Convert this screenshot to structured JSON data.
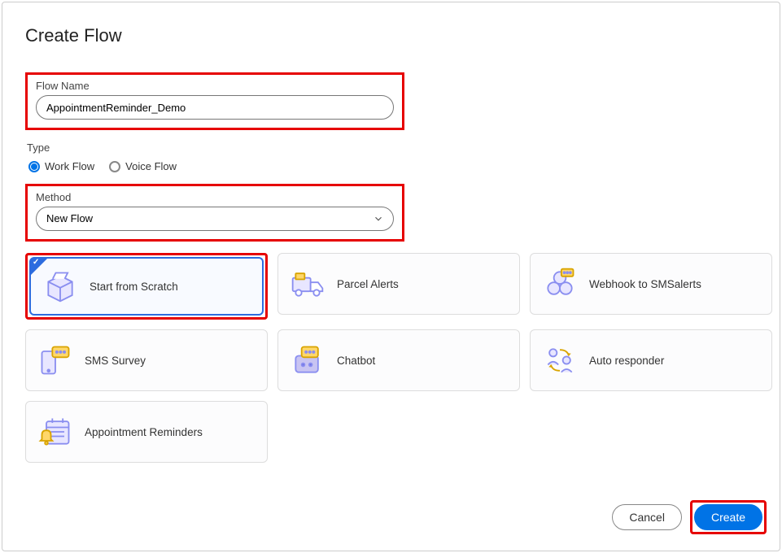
{
  "title": "Create Flow",
  "flowName": {
    "label": "Flow Name",
    "value": "AppointmentReminder_Demo"
  },
  "type": {
    "label": "Type",
    "options": [
      {
        "label": "Work Flow",
        "checked": true
      },
      {
        "label": "Voice Flow",
        "checked": false
      }
    ]
  },
  "method": {
    "label": "Method",
    "value": "New Flow"
  },
  "templates": [
    {
      "label": "Start from Scratch",
      "icon": "box",
      "selected": true
    },
    {
      "label": "Parcel Alerts",
      "icon": "truck",
      "selected": false
    },
    {
      "label": "Webhook to SMSalerts",
      "icon": "webhook",
      "selected": false
    },
    {
      "label": "SMS Survey",
      "icon": "sms-survey",
      "selected": false
    },
    {
      "label": "Chatbot",
      "icon": "chatbot",
      "selected": false
    },
    {
      "label": "Auto responder",
      "icon": "autoresponder",
      "selected": false
    },
    {
      "label": "Appointment Reminders",
      "icon": "appointment",
      "selected": false
    }
  ],
  "buttons": {
    "cancel": "Cancel",
    "create": "Create"
  }
}
